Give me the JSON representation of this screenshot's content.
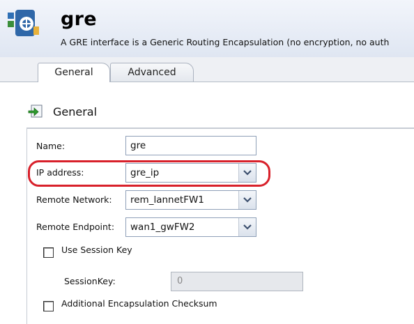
{
  "header": {
    "title": "gre",
    "subtitle": "A GRE interface is a Generic Routing Encapsulation (no encryption, no auth"
  },
  "tabs": [
    {
      "label": "General",
      "active": true
    },
    {
      "label": "Advanced",
      "active": false
    }
  ],
  "section": {
    "title": "General"
  },
  "form": {
    "name": {
      "label": "Name:",
      "value": "gre"
    },
    "ip_address": {
      "label": "IP address:",
      "value": "gre_ip"
    },
    "remote_network": {
      "label": "Remote Network:",
      "value": "rem_lannetFW1"
    },
    "remote_endpoint": {
      "label": "Remote Endpoint:",
      "value": "wan1_gwFW2"
    },
    "use_session_key": {
      "label": "Use Session Key",
      "checked": false
    },
    "session_key": {
      "label": "SessionKey:",
      "value": "0",
      "disabled": true
    },
    "additional_checksum": {
      "label": "Additional Encapsulation Checksum",
      "checked": false
    }
  },
  "colors": {
    "highlight": "#d8202a",
    "header_bg": "#dfe6f2",
    "input_border": "#8fa0b8"
  },
  "icons": [
    "gre-interface-icon",
    "section-arrow-icon",
    "dropdown-arrow-icon"
  ]
}
